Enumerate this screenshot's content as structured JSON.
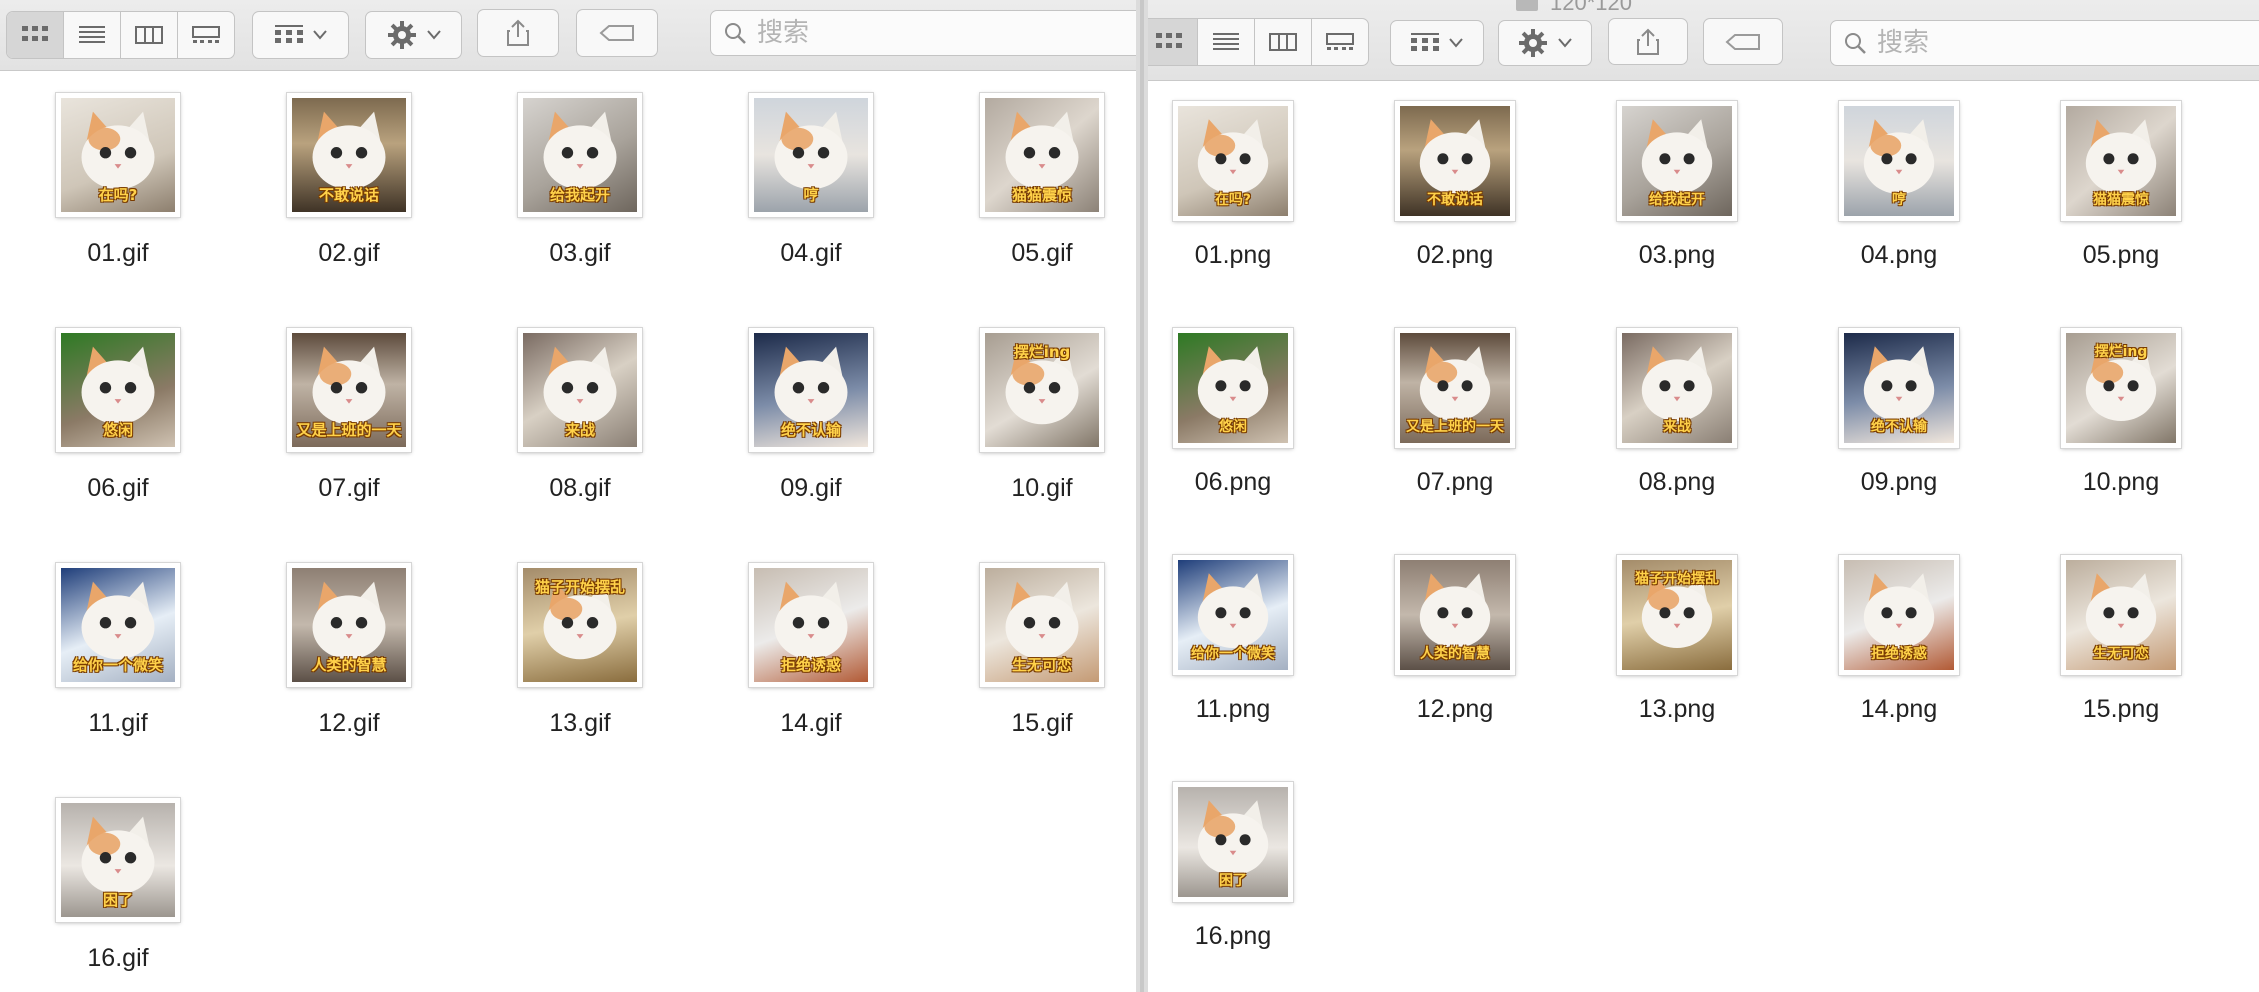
{
  "left": {
    "search_placeholder": "搜索",
    "files": [
      {
        "name": "01.gif",
        "caption": "在吗?"
      },
      {
        "name": "02.gif",
        "caption": "不敢说话"
      },
      {
        "name": "03.gif",
        "caption": "给我起开"
      },
      {
        "name": "04.gif",
        "caption": "哼"
      },
      {
        "name": "05.gif",
        "caption": "猫猫震惊"
      },
      {
        "name": "06.gif",
        "caption": "悠闲"
      },
      {
        "name": "07.gif",
        "caption": "又是上班的一天"
      },
      {
        "name": "08.gif",
        "caption": "来战"
      },
      {
        "name": "09.gif",
        "caption": "绝不认输"
      },
      {
        "name": "10.gif",
        "caption": "摆烂ing"
      },
      {
        "name": "11.gif",
        "caption": "给你一个微笑"
      },
      {
        "name": "12.gif",
        "caption": "人类的智慧"
      },
      {
        "name": "13.gif",
        "caption": "猫子开始摆乱"
      },
      {
        "name": "14.gif",
        "caption": "拒绝诱惑"
      },
      {
        "name": "15.gif",
        "caption": "生无可恋"
      },
      {
        "name": "16.gif",
        "caption": "困了"
      }
    ]
  },
  "right": {
    "search_placeholder": "搜索",
    "title_fragment": "120*120",
    "files": [
      {
        "name": "01.png",
        "caption": "在吗?"
      },
      {
        "name": "02.png",
        "caption": "不敢说话"
      },
      {
        "name": "03.png",
        "caption": "给我起开"
      },
      {
        "name": "04.png",
        "caption": "哼"
      },
      {
        "name": "05.png",
        "caption": "猫猫震惊"
      },
      {
        "name": "06.png",
        "caption": "悠闲"
      },
      {
        "name": "07.png",
        "caption": "又是上班的一天"
      },
      {
        "name": "08.png",
        "caption": "来战"
      },
      {
        "name": "09.png",
        "caption": "绝不认输"
      },
      {
        "name": "10.png",
        "caption": "摆烂ing"
      },
      {
        "name": "11.png",
        "caption": "给你一个微笑"
      },
      {
        "name": "12.png",
        "caption": "人类的智慧"
      },
      {
        "name": "13.png",
        "caption": "猫子开始摆乱"
      },
      {
        "name": "14.png",
        "caption": "拒绝诱惑"
      },
      {
        "name": "15.png",
        "caption": "生无可恋"
      },
      {
        "name": "16.png",
        "caption": "困了"
      }
    ]
  },
  "colors": {
    "caption_fill": "#ffd24a",
    "caption_stroke": "#7a3c00",
    "toolbar_bg": "#e6e6e6"
  },
  "icons": {
    "view_buttons": [
      "icon-view-icon",
      "list-view-icon",
      "column-view-icon",
      "gallery-view-icon"
    ],
    "group_button": "group-icon",
    "action_button": "gear-icon",
    "share_button": "share-icon",
    "tags_button": "tag-icon",
    "search": "search-icon"
  }
}
